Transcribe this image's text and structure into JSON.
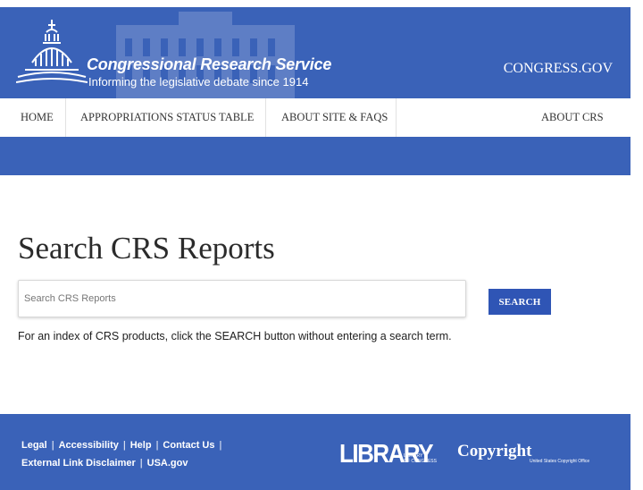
{
  "header": {
    "title": "Congressional Research Service",
    "tagline": "Informing the legislative debate since 1914",
    "congress_link": "CONGRESS.GOV"
  },
  "nav": {
    "items": [
      {
        "label": "HOME"
      },
      {
        "label": "APPROPRIATIONS STATUS TABLE"
      },
      {
        "label": "ABOUT SITE & FAQS"
      },
      {
        "label": "ABOUT CRS"
      }
    ]
  },
  "main": {
    "title": "Search CRS Reports",
    "search_placeholder": "Search CRS Reports",
    "search_value": "",
    "search_button": "SEARCH",
    "hint": "For an index of CRS products, click the SEARCH button without entering a search term."
  },
  "footer": {
    "links_row1": [
      "Legal",
      "Accessibility",
      "Help",
      "Contact Us"
    ],
    "links_row2": [
      "External Link Disclaimer",
      "USA.gov"
    ],
    "loc_logo": {
      "word": "LIBRARY",
      "sub1": "LIBRARY",
      "sub2": "OF CONGRESS"
    },
    "copyright_logo": {
      "word": "Copyright",
      "sub": "United States Copyright Office"
    }
  },
  "colors": {
    "brand_blue": "#3a62b8",
    "button_blue": "#2f55b5"
  },
  "icons": {
    "logo": "capitol-dome-icon"
  }
}
